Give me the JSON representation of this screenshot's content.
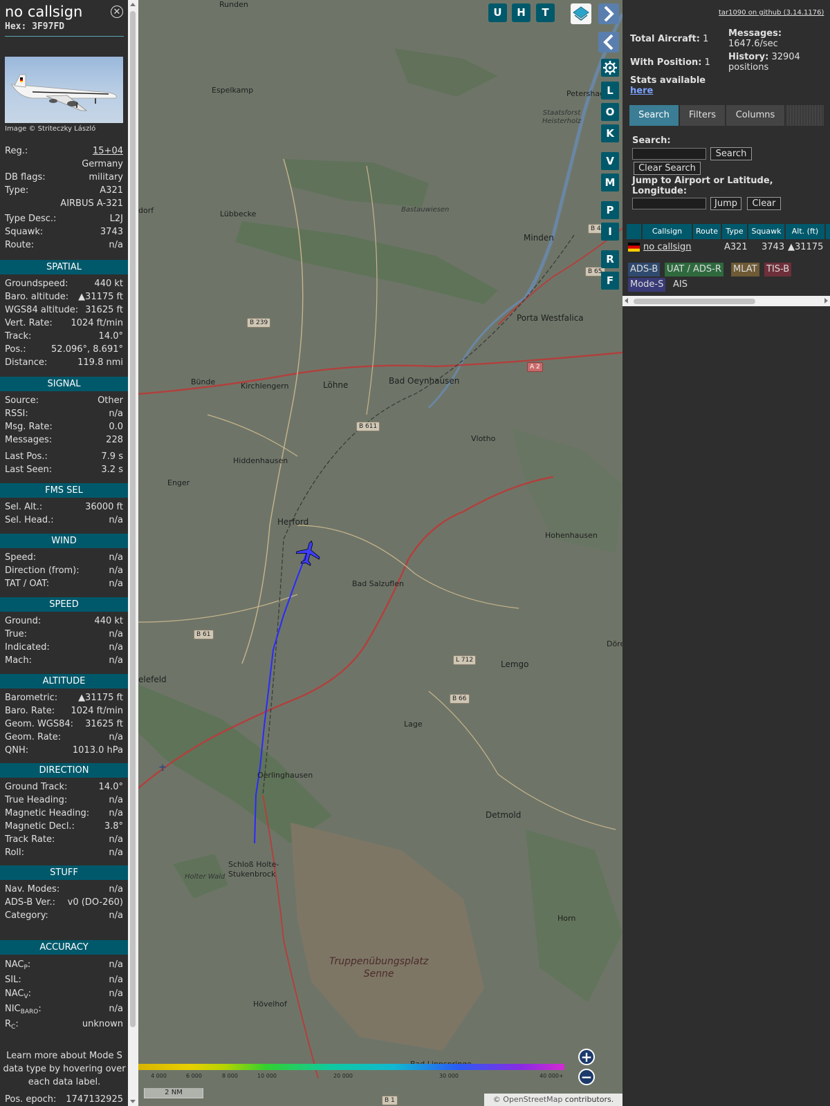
{
  "info": {
    "callsign": "no callsign",
    "hex": "Hex: 3F97FD",
    "photo_credit": "Image © Striteczky László",
    "reg": {
      "label": "Reg.:",
      "value": "15+04",
      "country": "Germany"
    },
    "db_flags": {
      "label": "DB flags:",
      "value": "military"
    },
    "type": {
      "label": "Type:",
      "value": "A321",
      "name": "AIRBUS A-321"
    },
    "type_desc": {
      "label": "Type Desc.:",
      "value": "L2J"
    },
    "squawk": {
      "label": "Squawk:",
      "value": "3743"
    },
    "route": {
      "label": "Route:",
      "value": "n/a"
    },
    "spatial": {
      "header": "SPATIAL",
      "rows": [
        {
          "label": "Groundspeed:",
          "value": "440 kt"
        },
        {
          "label": "Baro. altitude:",
          "value": "▲31175 ft"
        },
        {
          "label": "WGS84 altitude:",
          "value": "31625 ft"
        },
        {
          "label": "Vert. Rate:",
          "value": "1024 ft/min"
        },
        {
          "label": "Track:",
          "value": "14.0°"
        },
        {
          "label": "Pos.:",
          "value": "52.096°, 8.691°"
        },
        {
          "label": "Distance:",
          "value": "119.8 nmi"
        }
      ]
    },
    "signal": {
      "header": "SIGNAL",
      "rows": [
        {
          "label": "Source:",
          "value": "Other"
        },
        {
          "label": "RSSI:",
          "value": "n/a"
        },
        {
          "label": "Msg. Rate:",
          "value": "0.0"
        },
        {
          "label": "Messages:",
          "value": "228"
        },
        {
          "label": "Last Pos.:",
          "value": "7.9 s"
        },
        {
          "label": "Last Seen:",
          "value": "3.2 s"
        }
      ]
    },
    "fms": {
      "header": "FMS SEL",
      "rows": [
        {
          "label": "Sel. Alt.:",
          "value": "36000 ft"
        },
        {
          "label": "Sel. Head.:",
          "value": "n/a"
        }
      ]
    },
    "wind": {
      "header": "WIND",
      "rows": [
        {
          "label": "Speed:",
          "value": "n/a"
        },
        {
          "label": "Direction (from):",
          "value": "n/a"
        },
        {
          "label": "TAT / OAT:",
          "value": "n/a"
        }
      ]
    },
    "speed": {
      "header": "SPEED",
      "rows": [
        {
          "label": "Ground:",
          "value": "440 kt"
        },
        {
          "label": "True:",
          "value": "n/a"
        },
        {
          "label": "Indicated:",
          "value": "n/a"
        },
        {
          "label": "Mach:",
          "value": "n/a"
        }
      ]
    },
    "altitude": {
      "header": "ALTITUDE",
      "rows": [
        {
          "label": "Barometric:",
          "value": "▲31175 ft"
        },
        {
          "label": "Baro. Rate:",
          "value": "1024 ft/min"
        },
        {
          "label": "Geom. WGS84:",
          "value": "31625 ft"
        },
        {
          "label": "Geom. Rate:",
          "value": "n/a"
        },
        {
          "label": "QNH:",
          "value": "1013.0 hPa"
        }
      ]
    },
    "direction": {
      "header": "DIRECTION",
      "rows": [
        {
          "label": "Ground Track:",
          "value": "14.0°"
        },
        {
          "label": "True Heading:",
          "value": "n/a"
        },
        {
          "label": "Magnetic Heading:",
          "value": "n/a"
        },
        {
          "label": "Magnetic Decl.:",
          "value": "3.8°"
        },
        {
          "label": "Track Rate:",
          "value": "n/a"
        },
        {
          "label": "Roll:",
          "value": "n/a"
        }
      ]
    },
    "stuff": {
      "header": "STUFF",
      "rows": [
        {
          "label": "Nav. Modes:",
          "value": "n/a"
        },
        {
          "label": "ADS-B Ver.:",
          "value": "v0 (DO-260)"
        },
        {
          "label": "Category:",
          "value": "n/a"
        }
      ]
    },
    "accuracy": {
      "header": "ACCURACY",
      "rows": [
        {
          "label": "NAC",
          "sub": "P",
          "suffix": ":",
          "value": "n/a"
        },
        {
          "label": "SIL:",
          "sub": "",
          "suffix": "",
          "value": "n/a"
        },
        {
          "label": "NAC",
          "sub": "V",
          "suffix": ":",
          "value": "n/a"
        },
        {
          "label": "NIC",
          "sub": "BARO",
          "suffix": ":",
          "value": "n/a"
        },
        {
          "label": "R",
          "sub": "C",
          "suffix": ":",
          "value": "unknown"
        }
      ]
    },
    "note": "Learn more about Mode S data type by hovering over each data label.",
    "pos_epoch": {
      "label": "Pos. epoch:",
      "value": "1747132925"
    }
  },
  "map": {
    "buttons": {
      "u": "U",
      "h": "H",
      "t": "T"
    },
    "side_buttons": [
      "L",
      "O",
      "K",
      "V",
      "M",
      "P",
      "I",
      "R",
      "F"
    ],
    "towns": {
      "espelkamp": "Espelkamp",
      "petershagen": "Petershag",
      "staatsforst": "Staatsforst Heisterholz",
      "dorf": "dorf",
      "luebbecke": "Lübbecke",
      "bastauwiesen": "Bastauwiesen",
      "minden": "Minden",
      "porta": "Porta Westfalica",
      "buende": "Bünde",
      "kirchlengern": "Kirchlengern",
      "loehne": "Löhne",
      "bad_oeynhausen": "Bad Oeynhausen",
      "vlotho": "Vlotho",
      "hiddenhausen": "Hiddenhausen",
      "enger": "Enger",
      "herford": "Herford",
      "hohenhausen": "Hohenhausen",
      "bad_salzuflen": "Bad Salzuflen",
      "lemgo": "Lemgo",
      "dore": "Döre",
      "bielefeld": "elefeld",
      "lage": "Lage",
      "oerlinghausen": "Oerlinghausen",
      "detmold": "Detmold",
      "holter_wald": "Holter Wald",
      "schloss": "Schloß Holte-\nStukenbrock",
      "horn": "Horn",
      "senne": "Truppenübungsplatz\nSenne",
      "hoevelhof": "Hövelhof",
      "runden": "Runden",
      "bad_lippspringe": "Bad Lippspringe"
    },
    "roads": {
      "b239": "B 239",
      "b611": "B 611",
      "b61": "B 61",
      "l712": "L 712",
      "b66": "B 66",
      "a2": "A 2",
      "b65": "B 65",
      "b4": "B 4",
      "b1": "B 1"
    },
    "alt_ticks": [
      "4 000",
      "6 000",
      "8 000",
      "10 000",
      "20 000",
      "30 000",
      "40 000+"
    ],
    "scale_label": "2 NM",
    "attribution_a": "© OpenStreetMap",
    "attribution_b": " contributors."
  },
  "sidebar": {
    "github": "tar1090 on github (3.14.1176)",
    "total_aircraft_label": "Total Aircraft:",
    "total_aircraft": "1",
    "with_position_label": "With Position:",
    "with_position": "1",
    "messages_label": "Messages:",
    "messages_rate": "1647.6/sec",
    "history_label": "History:",
    "history_value": "32904",
    "history_unit": "positions",
    "stats_label": "Stats available",
    "stats_link": "here",
    "tabs": {
      "search": "Search",
      "filters": "Filters",
      "columns": "Columns"
    },
    "search_label": "Search:",
    "search_button": "Search",
    "clear_search_button": "Clear Search",
    "jump_label": "Jump to Airport or Latitude, Longitude:",
    "jump_button": "Jump",
    "clear_button": "Clear",
    "table": {
      "headers": {
        "callsign": "Callsign",
        "route": "Route",
        "type": "Type",
        "squawk": "Squawk",
        "alt": "Alt. (ft)"
      },
      "row": {
        "callsign": "no callsign",
        "type": "A321",
        "squawk": "3743",
        "alt": "▲31175"
      }
    },
    "sources": {
      "adsb": "ADS-B",
      "uat": "UAT / ADS-R",
      "mlat": "MLAT",
      "tisb": "TIS-B",
      "modes": "Mode-S",
      "ais": "AIS"
    },
    "colors": {
      "accent": "#00596b",
      "adsb": "#2f4a6e",
      "uat": "#2f6a3e",
      "mlat": "#6e5a35",
      "tisb": "#6e2f3a",
      "modes": "#3a3a78"
    }
  }
}
